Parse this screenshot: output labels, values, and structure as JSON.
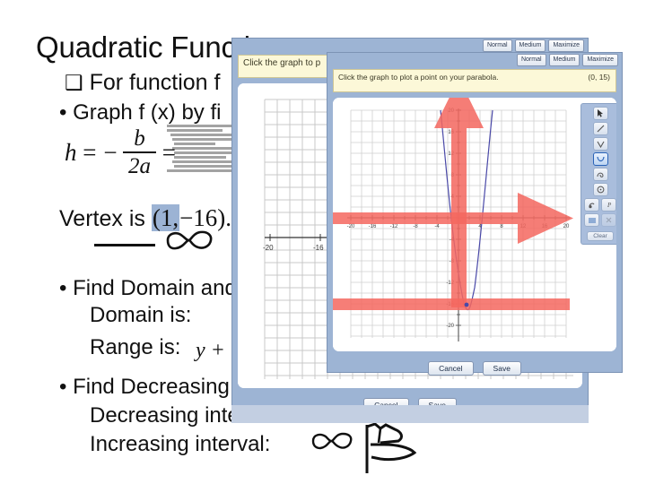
{
  "slide": {
    "title": "Quadratic Functions",
    "bullet_square": "❑",
    "bullet_function_text": "For function f",
    "bullet_dot": "•",
    "graph_line": "Graph f (x) by fi",
    "formula": {
      "lhs": "h",
      "eq": "=",
      "minus": "−",
      "numerator": "b",
      "denominator": "2a",
      "eq2": "="
    },
    "vertex_line_prefix": "Vertex is",
    "vertex_highlighted": "(1,",
    "vertex_rest": "−16).",
    "infinity_symbol": "∞",
    "find_domain_range": "Find Domain and",
    "domain_is": "Domain is:",
    "range_is": "Range is:",
    "range_math": "y +",
    "find_decreasing": "Find Decreasing",
    "decreasing_interval": "Decreasing inter",
    "increasing_interval": "Increasing interval:"
  },
  "dialog_back": {
    "instruction": "Click the graph to p",
    "size_buttons": [
      "Normal",
      "Medium",
      "Maximize"
    ],
    "cancel_label": "Cancel",
    "save_label": "Save"
  },
  "dialog_front": {
    "instruction": "Click the graph to plot a point on your parabola.",
    "coordinate_readout": "(0, 15)",
    "size_buttons": [
      "Normal",
      "Medium",
      "Maximize"
    ],
    "cancel_label": "Cancel",
    "save_label": "Save",
    "clear_label": "Clear",
    "tools": [
      {
        "name": "pointer-tool",
        "selected": false,
        "enabled": true
      },
      {
        "name": "line-tool",
        "selected": false,
        "enabled": true
      },
      {
        "name": "absolute-value-tool",
        "selected": false,
        "enabled": true
      },
      {
        "name": "parabola-tool",
        "selected": true,
        "enabled": true
      },
      {
        "name": "curve-tool",
        "selected": false,
        "enabled": true
      },
      {
        "name": "circle-tool",
        "selected": false,
        "enabled": true
      },
      {
        "name": "point-tool",
        "selected": false,
        "enabled": true
      },
      {
        "name": "label-tool",
        "selected": false,
        "enabled": true
      },
      {
        "name": "shade-tool",
        "selected": false,
        "enabled": true
      },
      {
        "name": "delete-tool",
        "selected": false,
        "enabled": false
      }
    ]
  },
  "chart_data": {
    "type": "line",
    "title": "",
    "xlabel": "",
    "ylabel": "",
    "xlim": [
      -22,
      22
    ],
    "ylim": [
      -22,
      22
    ],
    "xticks": [
      -20,
      -16,
      -12,
      -8,
      -4,
      4,
      8,
      12,
      16,
      20
    ],
    "yticks": [
      20,
      16,
      12,
      8,
      4,
      -4,
      -8,
      -12,
      -16,
      -20
    ],
    "grid": true,
    "legend": "none",
    "series": [
      {
        "name": "parabola",
        "color": "#4a49a8",
        "equation_vertex": [
          1,
          -16
        ],
        "x": [
          -3.2,
          -2,
          -1,
          0,
          1,
          2,
          3,
          4,
          5.2
        ],
        "y": [
          20.6,
          4,
          -4,
          -10,
          -16,
          -10,
          -4,
          4,
          20.6
        ]
      }
    ],
    "plotted_point": {
      "x": 1,
      "y": -16,
      "color": "#4a49a8"
    },
    "annotations": [
      {
        "name": "up-arrow",
        "color": "#f4675f",
        "direction": "up",
        "axis": "y"
      },
      {
        "name": "right-arrow",
        "color": "#f4675f",
        "direction": "right",
        "axis": "x"
      },
      {
        "name": "range-bar",
        "color": "#f4675f",
        "at_y": -16
      }
    ]
  },
  "colors": {
    "dialog_chrome": "#9db4d4",
    "instruction_bg": "#fcf8d8",
    "annotation_red": "#f4675f",
    "curve_blue": "#4a49a8",
    "highlight": "#9cb3d4"
  }
}
